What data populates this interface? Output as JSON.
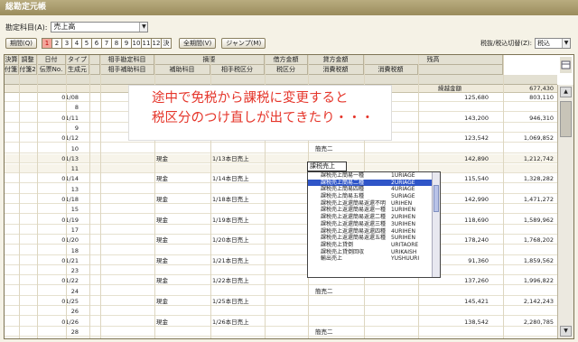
{
  "title": "総勘定元帳",
  "account": {
    "label": "勘定科目(A):",
    "value": "売上高"
  },
  "period_button": "期間(Q)",
  "months": [
    "1",
    "2",
    "3",
    "4",
    "5",
    "6",
    "7",
    "8",
    "9",
    "10",
    "11",
    "12",
    "決"
  ],
  "active_month": "1",
  "all_period_button": "全期間(V)",
  "jump_button": "ジャンプ(M)",
  "tax_switch": {
    "label": "税抜/税込切替(Z):",
    "value": "税込"
  },
  "headers_top": [
    "決算",
    "調整",
    "日付",
    "タイプ",
    "",
    "相手勘定科目",
    "摘要",
    "",
    "借方金額",
    "貸方金額",
    "残高"
  ],
  "headers_bottom": [
    "付箋1",
    "付箋2",
    "伝票No.",
    "生成元",
    "",
    "相手補助科目",
    "補助科目",
    "相手税区分",
    "税区分",
    "消費税額",
    "消費税額",
    ""
  ],
  "opening": {
    "label": "繰越金額",
    "value": "677,430"
  },
  "rows": [
    {
      "date": "01/08",
      "no": "",
      "acct": "現金",
      "memo": "1/8本日売上",
      "tax": "",
      "debit": "",
      "credit": "125,680",
      "bal": "803,110"
    },
    {
      "date": "",
      "no": "8",
      "acct": "",
      "memo": "",
      "tax": "",
      "debit": "",
      "credit": "",
      "bal": ""
    },
    {
      "date": "01/11",
      "no": "",
      "acct": "",
      "memo": "",
      "tax": "",
      "debit": "",
      "credit": "143,200",
      "bal": "946,310"
    },
    {
      "date": "",
      "no": "9",
      "acct": "",
      "memo": "",
      "tax": "",
      "debit": "",
      "credit": "",
      "bal": ""
    },
    {
      "date": "01/12",
      "no": "",
      "acct": "",
      "memo": "",
      "tax": "",
      "debit": "",
      "credit": "123,542",
      "bal": "1,069,852"
    },
    {
      "date": "",
      "no": "10",
      "acct": "",
      "memo": "",
      "tax": "簡売二",
      "debit": "",
      "credit": "",
      "bal": ""
    },
    {
      "date": "01/13",
      "no": "",
      "acct": "現金",
      "memo": "1/13本日売上",
      "tax": "",
      "debit": "",
      "credit": "142,890",
      "bal": "1,212,742"
    },
    {
      "date": "",
      "no": "11",
      "acct": "",
      "memo": "",
      "tax": "",
      "debit": "",
      "credit": "",
      "bal": ""
    },
    {
      "date": "01/14",
      "no": "",
      "acct": "現金",
      "memo": "1/14本日売上",
      "tax": "",
      "debit": "",
      "credit": "115,540",
      "bal": "1,328,282"
    },
    {
      "date": "",
      "no": "13",
      "acct": "",
      "memo": "",
      "tax": "",
      "debit": "",
      "credit": "",
      "bal": ""
    },
    {
      "date": "01/18",
      "no": "",
      "acct": "現金",
      "memo": "1/18本日売上",
      "tax": "",
      "debit": "",
      "credit": "142,990",
      "bal": "1,471,272"
    },
    {
      "date": "",
      "no": "15",
      "acct": "",
      "memo": "",
      "tax": "",
      "debit": "",
      "credit": "",
      "bal": ""
    },
    {
      "date": "01/19",
      "no": "",
      "acct": "現金",
      "memo": "1/19本日売上",
      "tax": "",
      "debit": "",
      "credit": "118,690",
      "bal": "1,589,962"
    },
    {
      "date": "",
      "no": "17",
      "acct": "",
      "memo": "",
      "tax": "",
      "debit": "",
      "credit": "",
      "bal": ""
    },
    {
      "date": "01/20",
      "no": "",
      "acct": "現金",
      "memo": "1/20本日売上",
      "tax": "",
      "debit": "",
      "credit": "178,240",
      "bal": "1,768,202"
    },
    {
      "date": "",
      "no": "18",
      "acct": "",
      "memo": "",
      "tax": "",
      "debit": "",
      "credit": "",
      "bal": ""
    },
    {
      "date": "01/21",
      "no": "",
      "acct": "現金",
      "memo": "1/21本日売上",
      "tax": "",
      "debit": "",
      "credit": "91,360",
      "bal": "1,859,562"
    },
    {
      "date": "",
      "no": "23",
      "acct": "",
      "memo": "",
      "tax": "",
      "debit": "",
      "credit": "",
      "bal": ""
    },
    {
      "date": "01/22",
      "no": "",
      "acct": "現金",
      "memo": "1/22本日売上",
      "tax": "",
      "debit": "",
      "credit": "137,260",
      "bal": "1,996,822"
    },
    {
      "date": "",
      "no": "24",
      "acct": "",
      "memo": "",
      "tax": "簡売二",
      "debit": "",
      "credit": "",
      "bal": ""
    },
    {
      "date": "01/25",
      "no": "",
      "acct": "現金",
      "memo": "1/25本日売上",
      "tax": "",
      "debit": "",
      "credit": "145,421",
      "bal": "2,142,243"
    },
    {
      "date": "",
      "no": "26",
      "acct": "",
      "memo": "",
      "tax": "",
      "debit": "",
      "credit": "",
      "bal": ""
    },
    {
      "date": "01/26",
      "no": "",
      "acct": "現金",
      "memo": "1/26本日売上",
      "tax": "",
      "debit": "",
      "credit": "138,542",
      "bal": "2,280,785"
    },
    {
      "date": "",
      "no": "28",
      "acct": "",
      "memo": "",
      "tax": "簡売二",
      "debit": "",
      "credit": "",
      "bal": ""
    }
  ],
  "callout": [
    "途中で免税から課税に変更すると",
    "税区分のつけ直しが出てきたり・・・"
  ],
  "dropdown_field": "課税売上",
  "dropdown": [
    {
      "name": "課税売上簡易一種",
      "code": "1URIAGE"
    },
    {
      "name": "課税売上簡易二種",
      "code": "2URIAGE"
    },
    {
      "name": "課税売上簡易四種",
      "code": "4URIAGE"
    },
    {
      "name": "課税売上簡易五種",
      "code": "5URIAGE"
    },
    {
      "name": "課税売上返還簡易返還不明",
      "code": "URIHEN"
    },
    {
      "name": "課税売上返還簡易返還一種",
      "code": "1URIHEN"
    },
    {
      "name": "課税売上返還簡易返還二種",
      "code": "2URIHEN"
    },
    {
      "name": "課税売上返還簡易返還三種",
      "code": "3URIHEN"
    },
    {
      "name": "課税売上返還簡易返還四種",
      "code": "4URIHEN"
    },
    {
      "name": "課税売上返還簡易返還五種",
      "code": "5URIHEN"
    },
    {
      "name": "課税売上貸倒",
      "code": "URITAORE"
    },
    {
      "name": "課税売上貸倒回収",
      "code": "URIKAISH"
    },
    {
      "name": "輸出売上",
      "code": "YUSHUURI"
    }
  ],
  "dropdown_highlight": 1
}
